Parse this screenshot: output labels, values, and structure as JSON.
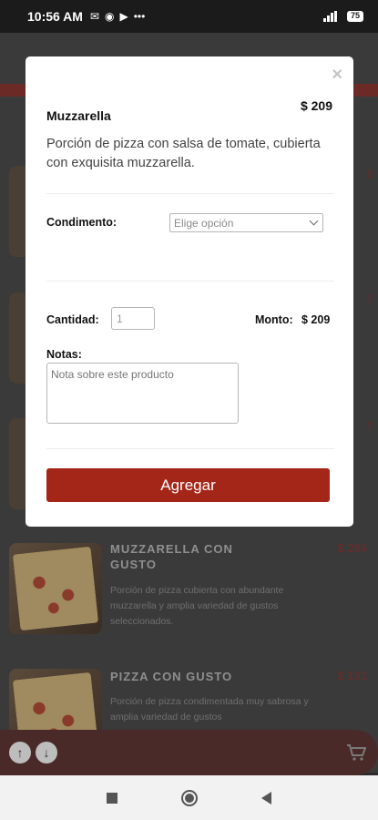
{
  "status_bar": {
    "time": "10:56 AM",
    "icons": [
      "mail-icon",
      "record-icon",
      "play-icon",
      "more-dots-icon"
    ],
    "battery": "75"
  },
  "modal": {
    "close_label": "×",
    "product_name": "Muzzarella",
    "product_price": "$ 209",
    "product_description": "Porción de pizza con salsa de tomate, cubierta con exquisita muzzarella.",
    "condiment_label": "Condimento:",
    "condiment_select_value": "Elige opción",
    "quantity_label": "Cantidad:",
    "quantity_value": "1",
    "amount_label": "Monto:",
    "amount_value": "$ 209",
    "notes_label": "Notas:",
    "notes_placeholder": "Nota sobre este producto",
    "add_button_label": "Agregar"
  },
  "background_menu": {
    "items": [
      {
        "name": "MUZZARELLA CON GUSTO",
        "price": "$ 284",
        "description": "Porción de pizza cubierta con abundante muzzarella y amplia variedad de gustos seleccionados."
      },
      {
        "name": "PIZZA CON GUSTO",
        "price": "$ 191",
        "description": "Porción de pizza condimentada muy sabrosa y amplia variedad de gustos"
      }
    ],
    "edge_prices": [
      "9",
      "7",
      "7"
    ]
  },
  "colors": {
    "accent": "#a42619",
    "overlay": "#3a3a3a"
  }
}
